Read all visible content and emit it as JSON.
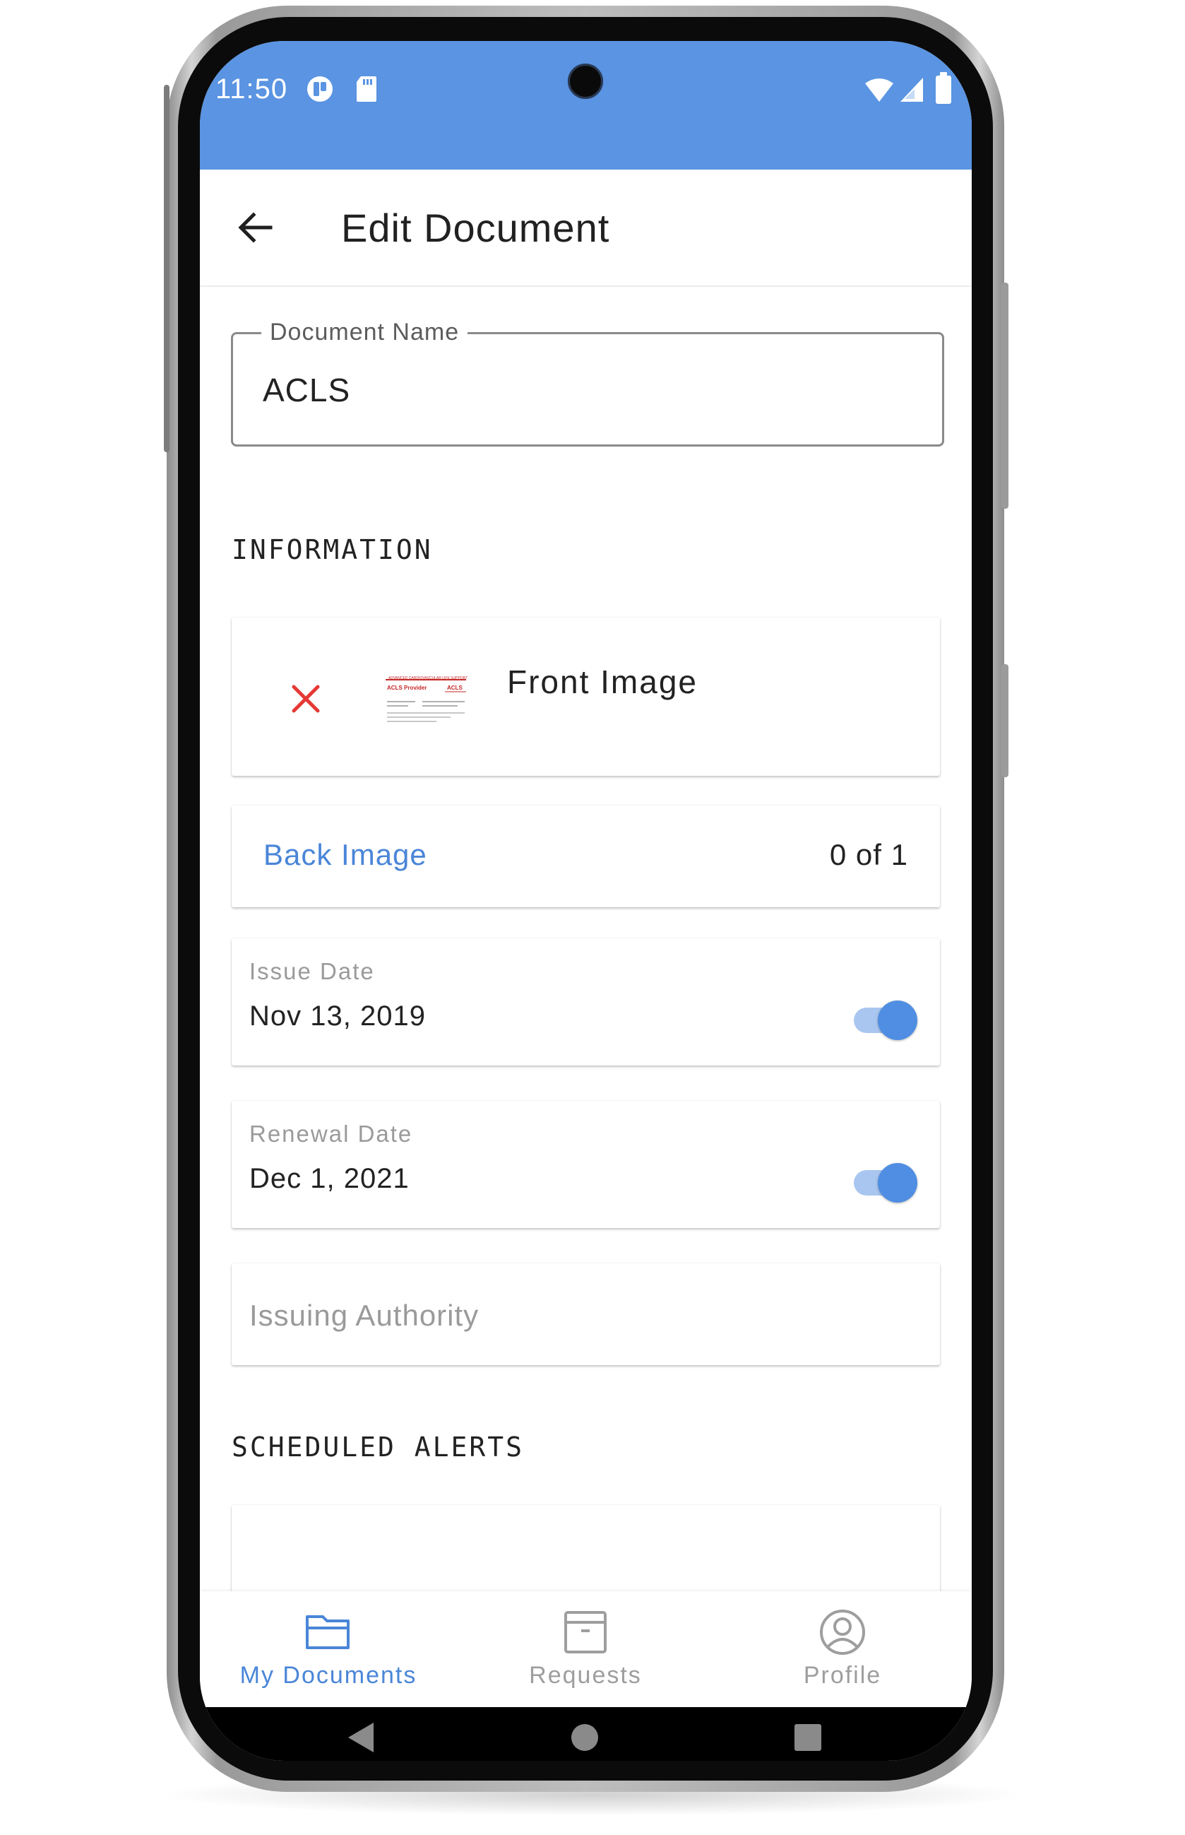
{
  "status_bar": {
    "time": "11:50",
    "color": "#5a94e2"
  },
  "app_bar": {
    "title": "Edit Document",
    "back_icon": "arrow-back-icon"
  },
  "document_name": {
    "label": "Document Name",
    "value": "ACLS"
  },
  "information": {
    "section_title": "INFORMATION",
    "front_image": {
      "label": "Front Image",
      "remove_icon": "close-icon",
      "thumbnail": {
        "title": "ADVANCED CARDIOVASCULAR LIFE SUPPORT",
        "left_text": "ACLS Provider",
        "right_text": "ACLS"
      }
    },
    "back_image": {
      "label": "Back Image",
      "count": "0 of 1"
    },
    "issue_date": {
      "label": "Issue Date",
      "value": "Nov 13, 2019",
      "enabled": true
    },
    "renewal_date": {
      "label": "Renewal Date",
      "value": "Dec 1, 2021",
      "enabled": true
    },
    "issuing_authority": {
      "placeholder": "Issuing Authority"
    }
  },
  "scheduled_alerts": {
    "section_title": "SCHEDULED ALERTS"
  },
  "bottom_nav": {
    "items": [
      {
        "label": "My Documents",
        "icon": "folder-icon",
        "active": true
      },
      {
        "label": "Requests",
        "icon": "archive-box-icon",
        "active": false
      },
      {
        "label": "Profile",
        "icon": "account-circle-icon",
        "active": false
      }
    ],
    "active_color": "#4a86d8",
    "inactive_color": "#9e9e9e"
  },
  "system_nav": {
    "buttons": [
      "back-triangle-icon",
      "home-circle-icon",
      "recents-square-icon"
    ]
  }
}
